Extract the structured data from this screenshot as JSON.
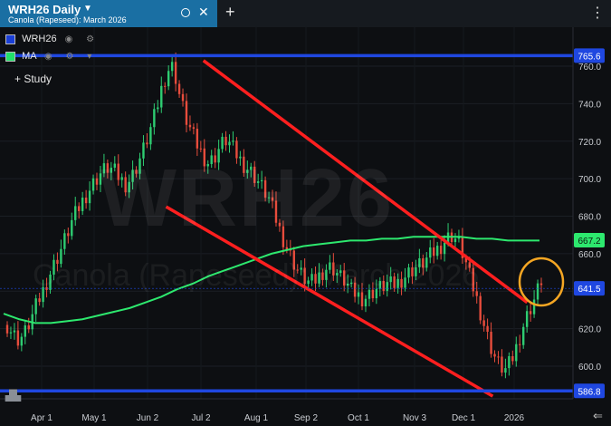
{
  "tab": {
    "title": "WRH26 Daily",
    "subtitle": "Canola (Rapeseed): March 2026",
    "add": "+",
    "more": "⋮",
    "close": "✕"
  },
  "legend": [
    {
      "label": "WRH26",
      "color": "#1a3fd6",
      "icons": "◉ ⚙"
    },
    {
      "label": "MA",
      "color": "#22e06a",
      "icons": "◉ ⚙ ▾"
    }
  ],
  "study_label": "+ Study",
  "watermark": {
    "ticker": "WRH26",
    "name": "Canola (Rapeseed): March 2026"
  },
  "colors": {
    "accent": "#1a6fa3",
    "hline": "#1f47e0",
    "trend": "#ff1f1f",
    "ma": "#2de86e",
    "up": "#2ecc71",
    "down": "#e74c3c",
    "circle": "#f5a623"
  },
  "chart_data": {
    "type": "line",
    "title": "WRH26 Daily",
    "ylim": [
      586,
      770
    ],
    "yticks": [
      600,
      620,
      640,
      660,
      680,
      700,
      720,
      740,
      760
    ],
    "xticks": [
      "Apr 1",
      "May 1",
      "Jun 2",
      "Jul 2",
      "Aug 1",
      "Sep 2",
      "Oct 1",
      "Nov 3",
      "Dec 1",
      "2026"
    ],
    "price_labels": [
      {
        "value": 765.6,
        "text": "765.6",
        "color": "#1f47e0"
      },
      {
        "value": 667.2,
        "text": "667.2",
        "color": "#2de86e"
      },
      {
        "value": 641.5,
        "text": "641.5",
        "color": "#1f47e0"
      },
      {
        "value": 586.8,
        "text": "586.8",
        "color": "#1f47e0"
      }
    ],
    "horizontal_lines": [
      765.6,
      586.8
    ],
    "price_close": [
      622,
      617,
      614,
      618,
      625,
      633,
      640,
      648,
      655,
      662,
      670,
      678,
      684,
      690,
      695,
      700,
      704,
      706,
      704,
      700,
      697,
      701,
      708,
      716,
      725,
      735,
      748,
      758,
      760,
      745,
      733,
      725,
      718,
      712,
      708,
      712,
      718,
      721,
      716,
      711,
      707,
      704,
      700,
      695,
      690,
      681,
      672,
      664,
      657,
      651,
      647,
      644,
      646,
      650,
      653,
      652,
      648,
      645,
      640,
      638,
      636,
      638,
      641,
      642,
      644,
      643,
      645,
      648,
      651,
      653,
      655,
      658,
      661,
      664,
      668,
      670,
      666,
      658,
      647,
      637,
      626,
      615,
      606,
      600,
      598,
      603,
      612,
      622,
      630,
      637,
      646
    ],
    "series": [
      {
        "name": "MA",
        "values": [
          628,
          625,
          623,
          623,
          624,
          625,
          627,
          629,
          631,
          634,
          637,
          641,
          644,
          648,
          651,
          654,
          657,
          660,
          662,
          664,
          665,
          666,
          667,
          667,
          668,
          668,
          669,
          669,
          669,
          669,
          668,
          668,
          667,
          667,
          667
        ]
      }
    ],
    "trendlines": [
      {
        "name": "upper",
        "from": [
          0.355,
          763
        ],
        "to": [
          0.92,
          634
        ]
      },
      {
        "name": "lower",
        "from": [
          0.29,
          685
        ],
        "to": [
          0.86,
          584
        ]
      }
    ]
  }
}
